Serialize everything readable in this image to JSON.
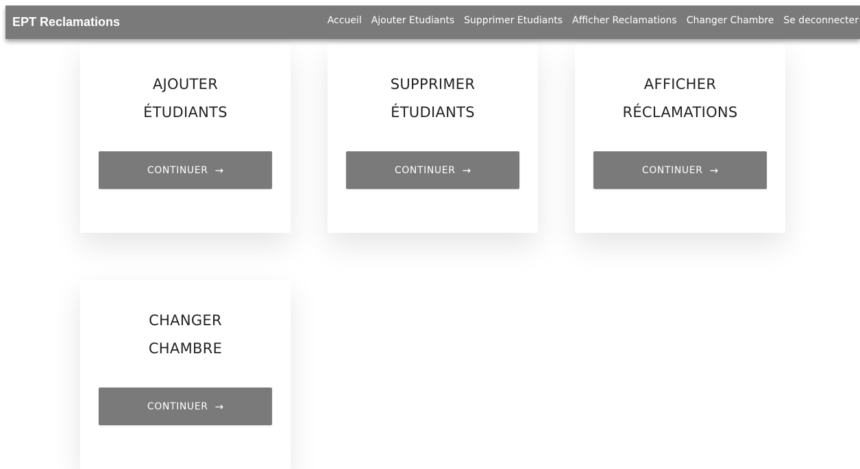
{
  "navbar": {
    "brand": "EPT Reclamations",
    "links": [
      "Accueil",
      "Ajouter Etudiants",
      "Supprimer Etudiants",
      "Afficher Reclamations",
      "Changer Chambre",
      "Se deconnecter"
    ]
  },
  "cards": [
    {
      "title_line1": "AJOUTER",
      "title_line2": "ÉTUDIANTS",
      "button_label": "CONTINUER",
      "button_icon": "→"
    },
    {
      "title_line1": "SUPPRIMER",
      "title_line2": "ÉTUDIANTS",
      "button_label": "CONTINUER",
      "button_icon": "→"
    },
    {
      "title_line1": "AFFICHER",
      "title_line2": "RÉCLAMATIONS",
      "button_label": "CONTINUER",
      "button_icon": "→"
    },
    {
      "title_line1": "CHANGER",
      "title_line2": "CHAMBRE",
      "button_label": "CONTINUER",
      "button_icon": "→"
    }
  ],
  "colors": {
    "navbar_bg": "#7a7a7a",
    "button_bg": "#7a7a7a",
    "text_on_dark": "#ffffff",
    "card_title": "#222222"
  },
  "icons": {
    "button_arrow": "right-arrow-icon"
  }
}
